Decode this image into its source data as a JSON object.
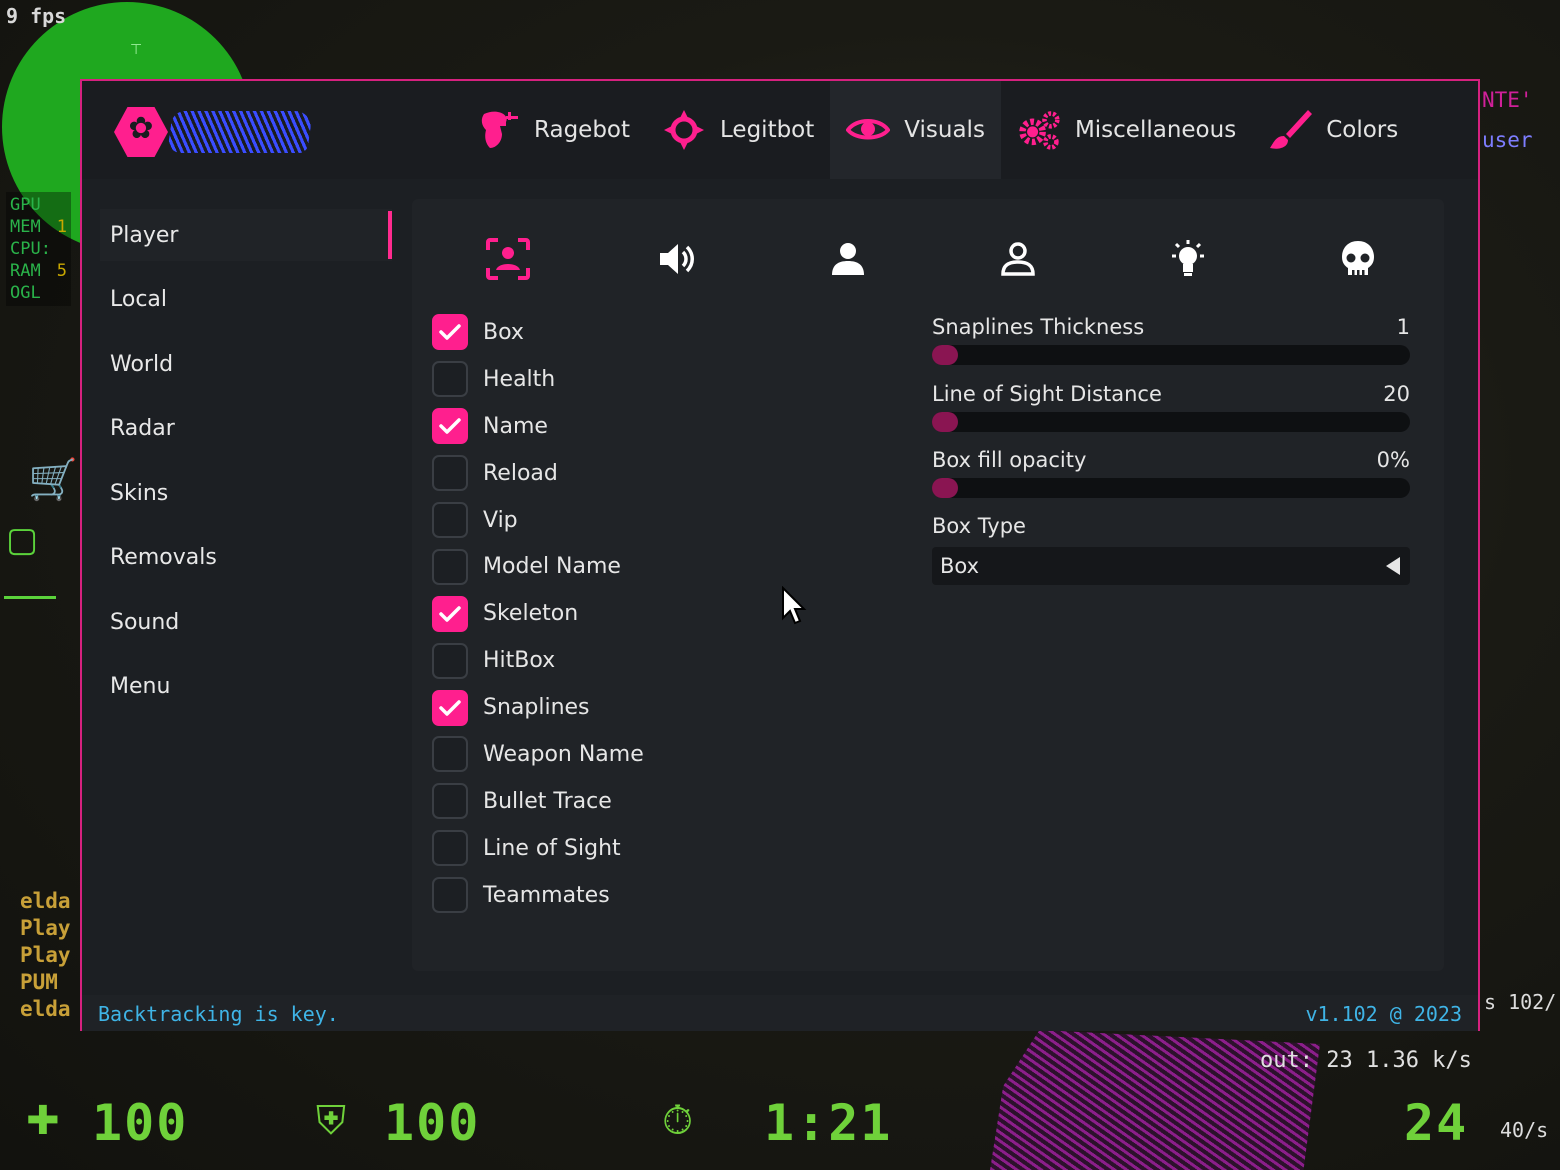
{
  "game": {
    "fps": "9 fps",
    "perf": [
      {
        "label": "GPU",
        "value": ""
      },
      {
        "label": "MEM",
        "value": "1"
      },
      {
        "label": "CPU:",
        "value": ""
      },
      {
        "label": "RAM",
        "value": "5"
      },
      {
        "label": "OGL",
        "value": ""
      }
    ],
    "killfeed": [
      "elda",
      "Play",
      "Play",
      "PUM",
      "elda"
    ],
    "topright": [
      "NTE'",
      "user"
    ],
    "netstats": "s 102/",
    "netout": "out: 23 1.36 k/s",
    "hud": {
      "health": "100",
      "armor": "100",
      "time": "1:21",
      "ammo": "24",
      "rate": "40/s"
    }
  },
  "menu": {
    "accent": "#ff1f8e",
    "tabs": [
      {
        "label": "Ragebot",
        "icon": "ragebot-icon",
        "active": false
      },
      {
        "label": "Legitbot",
        "icon": "crosshair-icon",
        "active": false
      },
      {
        "label": "Visuals",
        "icon": "eye-icon",
        "active": true
      },
      {
        "label": "Miscellaneous",
        "icon": "gears-icon",
        "active": false
      },
      {
        "label": "Colors",
        "icon": "brush-icon",
        "active": false
      }
    ],
    "sidebar": [
      {
        "label": "Player",
        "active": true
      },
      {
        "label": "Local"
      },
      {
        "label": "World"
      },
      {
        "label": "Radar"
      },
      {
        "label": "Skins"
      },
      {
        "label": "Removals"
      },
      {
        "label": "Sound"
      },
      {
        "label": "Menu"
      }
    ],
    "subtabs": [
      "face-scan-icon",
      "speaker-icon",
      "person-filled-icon",
      "person-outline-icon",
      "lightbulb-icon",
      "skull-icon"
    ],
    "checkboxes": [
      {
        "label": "Box",
        "checked": true
      },
      {
        "label": "Health",
        "checked": false
      },
      {
        "label": "Name",
        "checked": true
      },
      {
        "label": "Reload",
        "checked": false
      },
      {
        "label": "Vip",
        "checked": false
      },
      {
        "label": "Model Name",
        "checked": false
      },
      {
        "label": "Skeleton",
        "checked": true
      },
      {
        "label": "HitBox",
        "checked": false
      },
      {
        "label": "Snaplines",
        "checked": true
      },
      {
        "label": "Weapon Name",
        "checked": false
      },
      {
        "label": "Bullet Trace",
        "checked": false
      },
      {
        "label": "Line of Sight",
        "checked": false
      },
      {
        "label": "Teammates",
        "checked": false
      }
    ],
    "sliders": [
      {
        "label": "Snaplines Thickness",
        "value": "1",
        "fraction": 0
      },
      {
        "label": "Line of Sight Distance",
        "value": "20",
        "fraction": 0
      },
      {
        "label": "Box fill opacity",
        "value": "0%",
        "fraction": 0
      }
    ],
    "box_type": {
      "label": "Box Type",
      "value": "Box"
    },
    "footer": {
      "left": "Backtracking is key.",
      "right": "v1.102 @ 2023"
    }
  }
}
